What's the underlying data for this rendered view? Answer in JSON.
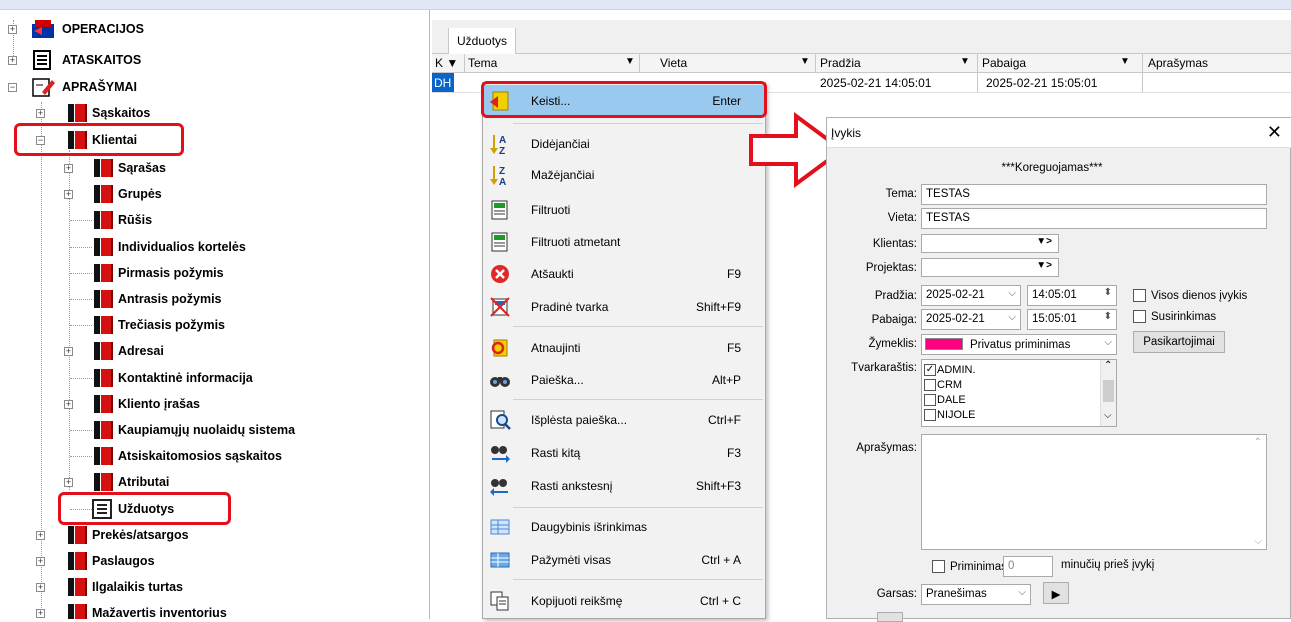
{
  "tree": {
    "top": [
      {
        "label": "OPERACIJOS",
        "icon": "operations-icon"
      },
      {
        "label": "ATASKAITOS",
        "icon": "reports-icon"
      },
      {
        "label": "APRAŠYMAI",
        "icon": "descriptions-icon"
      }
    ],
    "level1": [
      "Sąskaitos",
      "Klientai"
    ],
    "klientai_children": [
      "Sąrašas",
      "Grupės",
      "Rūšis",
      "Individualios kortelės",
      "Pirmasis požymis",
      "Antrasis požymis",
      "Trečiasis požymis",
      "Adresai",
      "Kontaktinė informacija",
      "Kliento įrašas",
      "Kaupiamųjų nuolaidų sistema",
      "Atsiskaitomosios sąskaitos",
      "Atributai",
      "Užduotys"
    ],
    "after": [
      "Prekės/atsargos",
      "Paslaugos",
      "Ilgalaikis turtas",
      "Mažavertis inventorius"
    ]
  },
  "tab": {
    "label": "Užduotys"
  },
  "grid": {
    "headers": [
      "K",
      "Tema",
      "Vieta",
      "Pradžia",
      "Pabaiga",
      "Aprašymas"
    ],
    "row": {
      "k": "DH",
      "pradzia": "2025-02-21 14:05:01",
      "pabaiga": "2025-02-21 15:05:01"
    }
  },
  "menu": [
    {
      "label": "Keisti...",
      "shortcut": "Enter",
      "icon": "edit-icon"
    },
    {
      "label": "Didėjančiai",
      "shortcut": "",
      "icon": "sort-asc-icon"
    },
    {
      "label": "Mažėjančiai",
      "shortcut": "",
      "icon": "sort-desc-icon"
    },
    {
      "label": "Filtruoti",
      "shortcut": "",
      "icon": "filter-icon"
    },
    {
      "label": "Filtruoti atmetant",
      "shortcut": "",
      "icon": "filter-exclude-icon"
    },
    {
      "label": "Atšaukti",
      "shortcut": "F9",
      "icon": "cancel-icon"
    },
    {
      "label": "Pradinė tvarka",
      "shortcut": "Shift+F9",
      "icon": "reset-order-icon"
    },
    {
      "label": "Atnaujinti",
      "shortcut": "F5",
      "icon": "refresh-icon"
    },
    {
      "label": "Paieška...",
      "shortcut": "Alt+P",
      "icon": "binoculars-icon"
    },
    {
      "label": "Išplėsta paieška...",
      "shortcut": "Ctrl+F",
      "icon": "advanced-search-icon"
    },
    {
      "label": "Rasti kitą",
      "shortcut": "F3",
      "icon": "find-next-icon"
    },
    {
      "label": "Rasti ankstesnį",
      "shortcut": "Shift+F3",
      "icon": "find-prev-icon"
    },
    {
      "label": "Daugybinis išrinkimas",
      "shortcut": "",
      "icon": "multi-select-icon"
    },
    {
      "label": "Pažymėti visas",
      "shortcut": "Ctrl + A",
      "icon": "select-all-icon"
    },
    {
      "label": "Kopijuoti reikšmę",
      "shortcut": "Ctrl + C",
      "icon": "copy-icon"
    }
  ],
  "dialog": {
    "title": "Įvykis",
    "status": "***Koreguojamas***",
    "tema_label": "Tema:",
    "tema_value": "TESTAS",
    "vieta_label": "Vieta:",
    "vieta_value": "TESTAS",
    "klientas_label": "Klientas:",
    "projektas_label": "Projektas:",
    "pradzia_label": "Pradžia:",
    "pradzia_date": "2025-02-21",
    "pradzia_time": "14:05:01",
    "pabaiga_label": "Pabaiga:",
    "pabaiga_date": "2025-02-21",
    "pabaiga_time": "15:05:01",
    "all_day_label": "Visos dienos įvykis",
    "meeting_label": "Susirinkimas",
    "zymeklis_label": "Žymeklis:",
    "zymeklis_value": "Privatus priminimas",
    "zymeklis_color": "#ff0080",
    "repeat_button": "Pasikartojimai",
    "tvarkarastis_label": "Tvarkaraštis:",
    "schedule_items": [
      {
        "label": "ADMIN.",
        "checked": true
      },
      {
        "label": "CRM",
        "checked": false
      },
      {
        "label": "DALE",
        "checked": false
      },
      {
        "label": "NIJOLE",
        "checked": false
      }
    ],
    "aprasymas_label": "Aprašymas:",
    "reminder_label": "Priminimas",
    "reminder_value": "0",
    "reminder_suffix": "minučių prieš įvykį",
    "garsas_label": "Garsas:",
    "garsas_value": "Pranešimas"
  }
}
